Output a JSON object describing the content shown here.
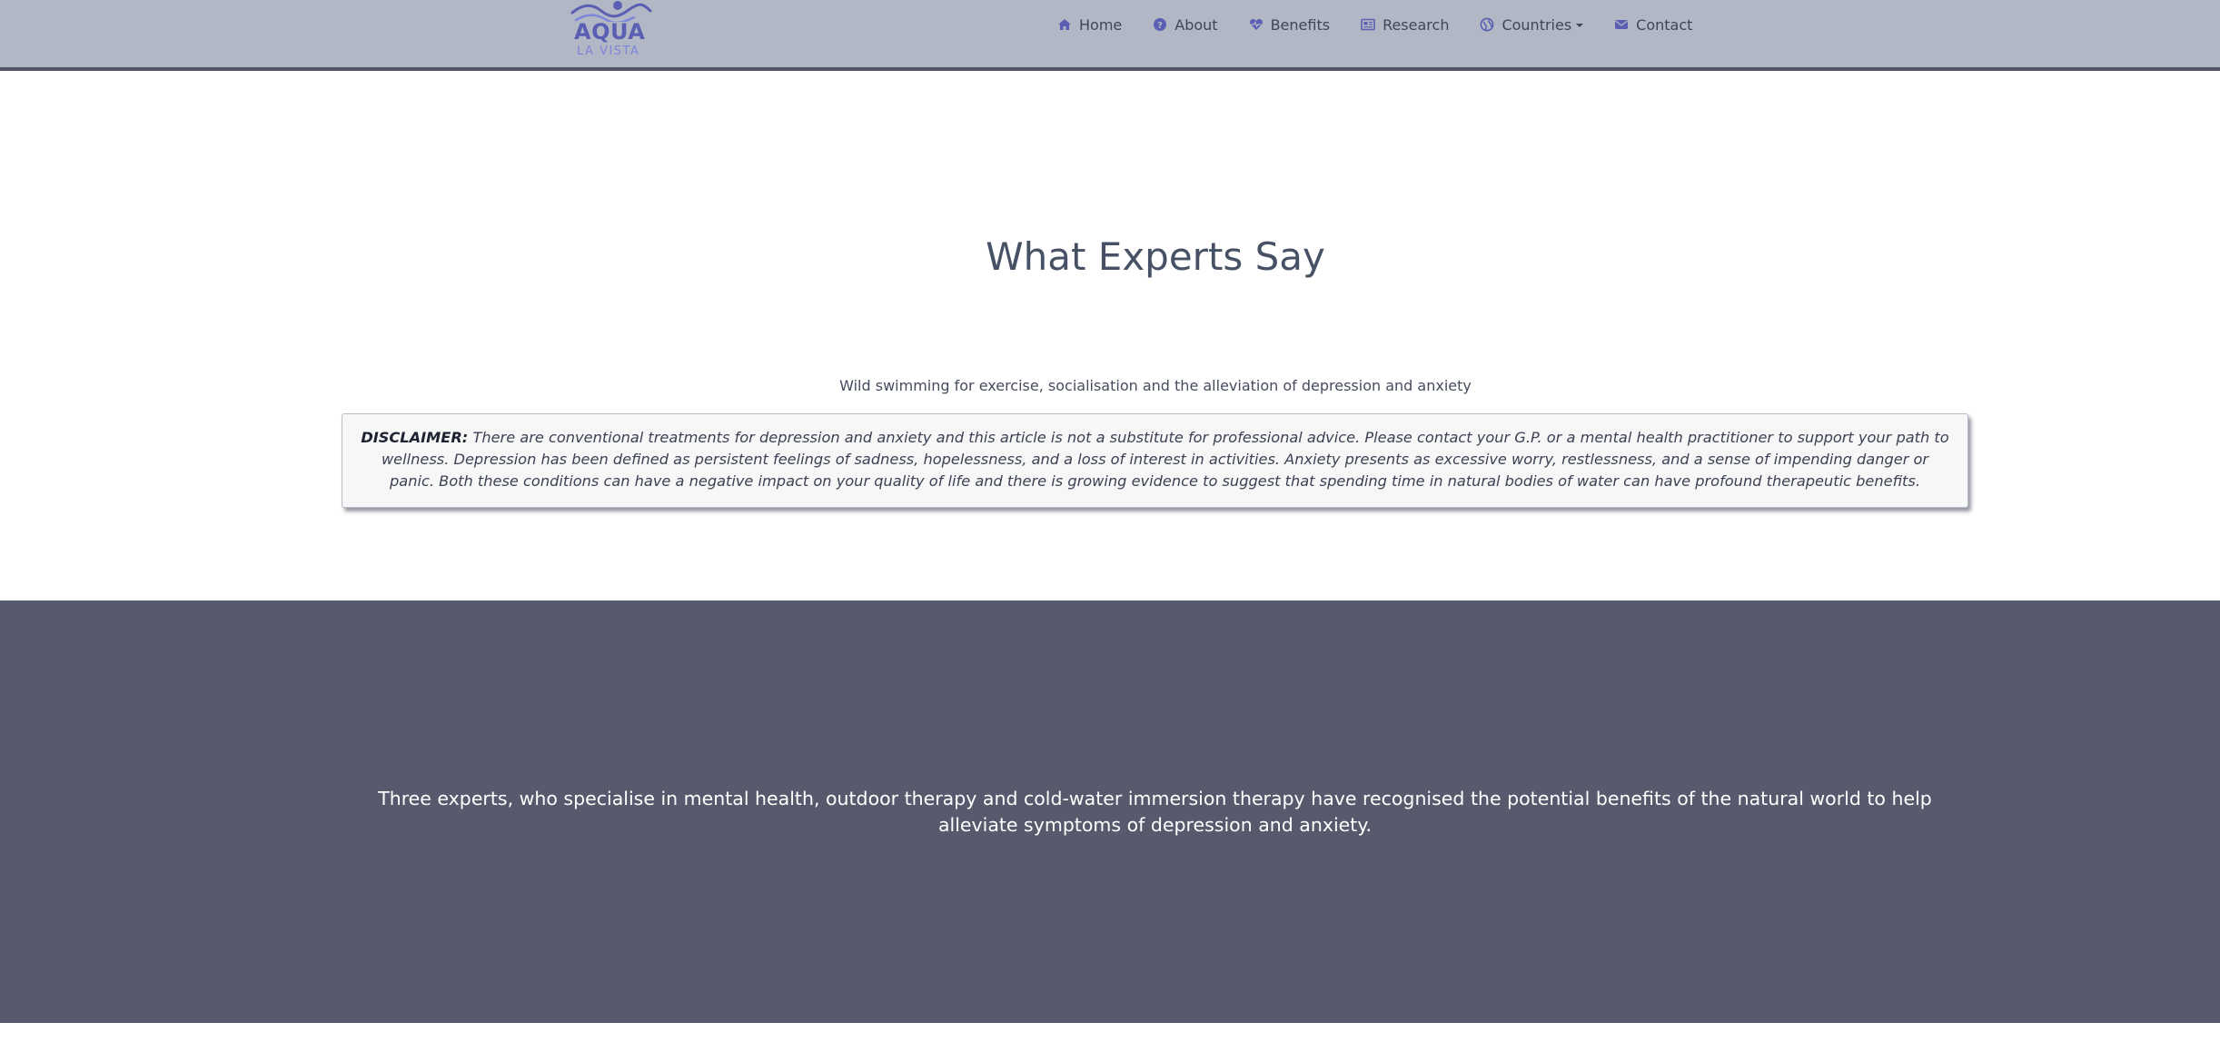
{
  "brand": {
    "name": "AQUA",
    "tagline": "LA VISTA",
    "color_primary": "#5b5fb4",
    "color_secondary": "#7d86dd"
  },
  "nav": {
    "items": [
      {
        "label": "Home",
        "icon": "home-icon"
      },
      {
        "label": "About",
        "icon": "question-circle-icon"
      },
      {
        "label": "Benefits",
        "icon": "heartbeat-icon"
      },
      {
        "label": "Research",
        "icon": "newspaper-icon"
      },
      {
        "label": "Countries",
        "icon": "globe-icon",
        "dropdown": true
      },
      {
        "label": "Contact",
        "icon": "envelope-icon"
      }
    ],
    "icon_color": "#5b5fb4",
    "background": "#b1b7c4"
  },
  "hero": {
    "title": "What Experts Say",
    "subtitle": "Wild swimming for exercise, socialisation and the alleviation of depression and anxiety"
  },
  "disclaimer": {
    "label": "DISCLAIMER:",
    "text": "There are conventional treatments for depression and anxiety and this article is not a substitute for professional advice. Please contact your G.P. or a mental health practitioner to support your path to wellness. Depression has been defined as persistent feelings of sadness, hopelessness, and a loss of interest in activities. Anxiety presents as excessive worry, restlessness, and a sense of impending danger or panic. Both these conditions can have a negative impact on your quality of life and there is growing evidence to suggest that spending time in natural bodies of water can have profound therapeutic benefits."
  },
  "intro_section": {
    "background": "#575a6c",
    "text": "Three experts, who specialise in mental health, outdoor therapy and cold-water immersion therapy have recognised the potential benefits of the natural world to help alleviate symptoms of depression and anxiety."
  }
}
